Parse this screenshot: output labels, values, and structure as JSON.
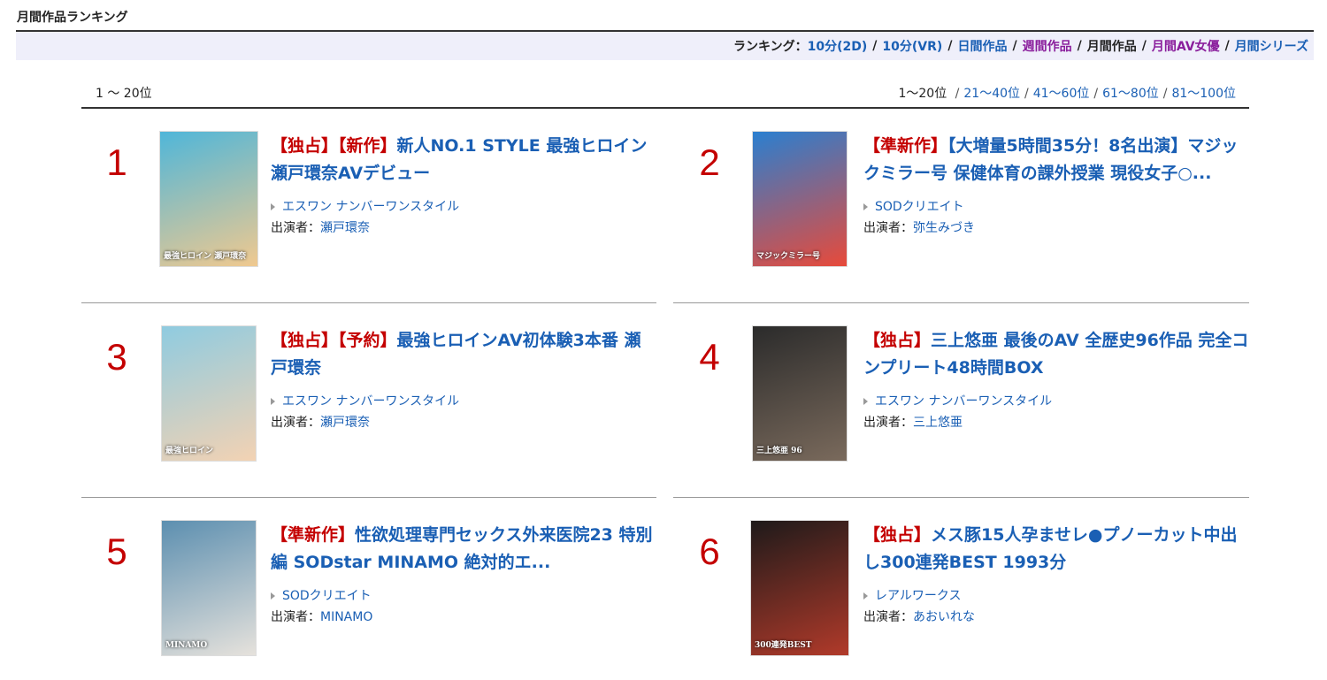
{
  "page": {
    "heading": "月間作品ランキング"
  },
  "nav": {
    "label": "ランキング：",
    "links": [
      {
        "text": "10分(2D)",
        "style": "blue"
      },
      {
        "text": "10分(VR)",
        "style": "blue"
      },
      {
        "text": "日間作品",
        "style": "blue"
      },
      {
        "text": "週間作品",
        "style": "purple"
      },
      {
        "text": "月間作品",
        "style": "current"
      },
      {
        "text": "月間AV女優",
        "style": "purple"
      },
      {
        "text": "月間シリーズ",
        "style": "blue"
      }
    ]
  },
  "range_label": "1 〜 20位",
  "pager": {
    "current": "1〜20位",
    "links": [
      "21〜40位",
      "41〜60位",
      "61〜80位",
      "81〜100位"
    ]
  },
  "cast_prefix": "出演者：",
  "items": [
    {
      "rank": "1",
      "tags": [
        "【独占】",
        "【新作】"
      ],
      "title": "新人NO.1 STYLE 最強ヒロイン瀬戸環奈AVデビュー",
      "label": "エスワン ナンバーワンスタイル",
      "cast": "瀬戸環奈",
      "cover_text": "最強ヒロイン 瀬戸環奈",
      "cover_colors": [
        "#4fb6d9",
        "#f0c98f"
      ]
    },
    {
      "rank": "2",
      "tags": [
        "【準新作】"
      ],
      "title": "【大増量5時間35分！8名出演】マジックミラー号 保健体育の課外授業 現役女子○...",
      "label": "SODクリエイト",
      "cast": "弥生みづき",
      "cover_text": "マジックミラー号",
      "cover_colors": [
        "#2a7fd0",
        "#e84a3a"
      ]
    },
    {
      "rank": "3",
      "tags": [
        "【独占】",
        "【予約】"
      ],
      "title": "最強ヒロインAV初体験3本番 瀬戸環奈",
      "label": "エスワン ナンバーワンスタイル",
      "cast": "瀬戸環奈",
      "cover_text": "最強ヒロイン",
      "cover_colors": [
        "#8fcbe0",
        "#f3d2b3"
      ]
    },
    {
      "rank": "4",
      "tags": [
        "【独占】"
      ],
      "title": "三上悠亜 最後のAV 全歴史96作品 完全コンプリート48時間BOX",
      "label": "エスワン ナンバーワンスタイル",
      "cast": "三上悠亜",
      "cover_text": "三上悠亜 96",
      "cover_colors": [
        "#2b2b2b",
        "#7a6a5c"
      ]
    },
    {
      "rank": "5",
      "tags": [
        "【準新作】"
      ],
      "title": "性欲処理専門セックス外来医院23 特別編 SODstar MINAMO 絶対的エ...",
      "label": "SODクリエイト",
      "cast": "MINAMO",
      "cover_text": "MINAMO",
      "cover_colors": [
        "#5c8fb0",
        "#e6e2dc"
      ]
    },
    {
      "rank": "6",
      "tags": [
        "【独占】"
      ],
      "title": "メス豚15人孕ませレ●プノーカット中出し300連発BEST 1993分",
      "label": "レアルワークス",
      "cast": "あおいれな",
      "cover_text": "300連発BEST",
      "cover_colors": [
        "#1e1a1a",
        "#b13a2a"
      ]
    }
  ]
}
